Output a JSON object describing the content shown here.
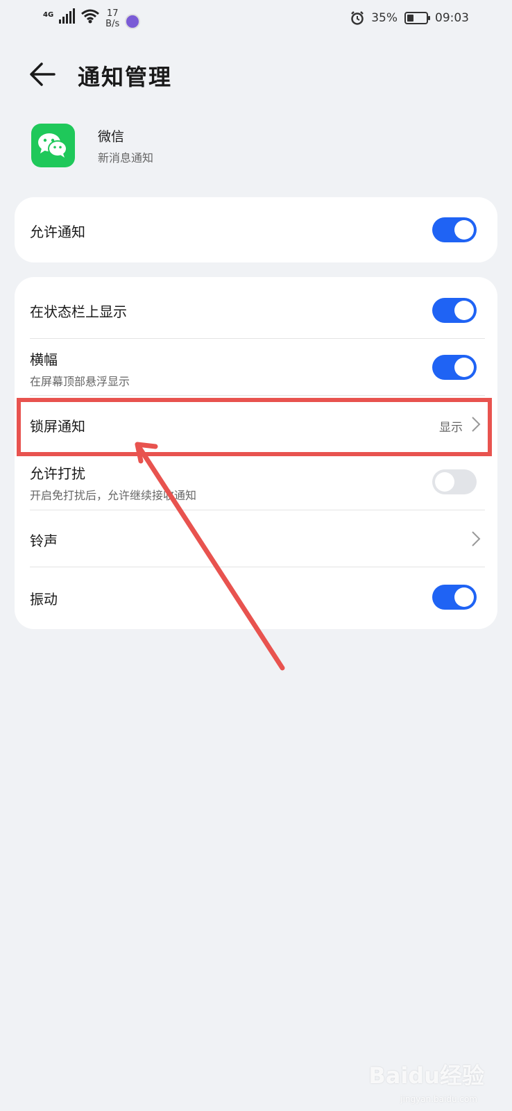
{
  "status_bar": {
    "network": "4G",
    "speed_value": "17",
    "speed_unit": "B/s",
    "battery_percent": "35%",
    "battery_level": 0.35,
    "time": "09:03"
  },
  "header": {
    "title": "通知管理",
    "back_icon": "arrow-left-icon"
  },
  "app": {
    "name": "微信",
    "subtitle": "新消息通知",
    "icon": "wechat-icon",
    "icon_color": "#1fc85a"
  },
  "card1": {
    "rows": [
      {
        "label": "允许通知",
        "toggle": true
      }
    ]
  },
  "card2": {
    "rows": [
      {
        "label": "在状态栏上显示",
        "toggle": true
      },
      {
        "label": "横幅",
        "sub": "在屏幕顶部悬浮显示",
        "toggle": true
      },
      {
        "label": "锁屏通知",
        "value": "显示"
      },
      {
        "label": "允许打扰",
        "sub": "开启免打扰后，允许继续接收通知",
        "toggle": false
      },
      {
        "label": "铃声"
      },
      {
        "label": "振动",
        "toggle": true
      }
    ]
  },
  "colors": {
    "toggle_on": "#1f63f4",
    "toggle_off": "#e2e4e8",
    "annotation": "#e8534f",
    "background": "#f0f2f5"
  },
  "watermark": {
    "text": "Baidu经验",
    "url": "jingyan.baidu.com"
  }
}
